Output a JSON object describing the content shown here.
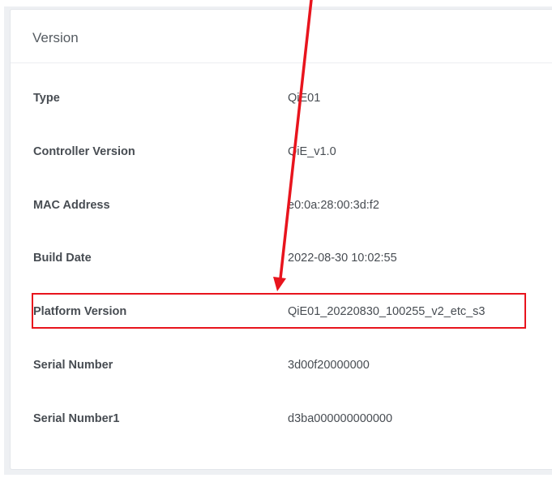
{
  "panel": {
    "title": "Version"
  },
  "rows": [
    {
      "label": "Type",
      "value": "QiE01"
    },
    {
      "label": "Controller Version",
      "value": "QiE_v1.0"
    },
    {
      "label": "MAC Address",
      "value": "e0:0a:28:00:3d:f2"
    },
    {
      "label": "Build Date",
      "value": "2022-08-30 10:02:55"
    },
    {
      "label": "Platform Version",
      "value": "QiE01_20220830_100255_v2_etc_s3"
    },
    {
      "label": "Serial Number",
      "value": "3d00f20000000"
    },
    {
      "label": "Serial Number1",
      "value": "d3ba000000000000"
    }
  ],
  "annotation": {
    "color": "#e8141d",
    "highlighted_row": "Platform Version"
  }
}
